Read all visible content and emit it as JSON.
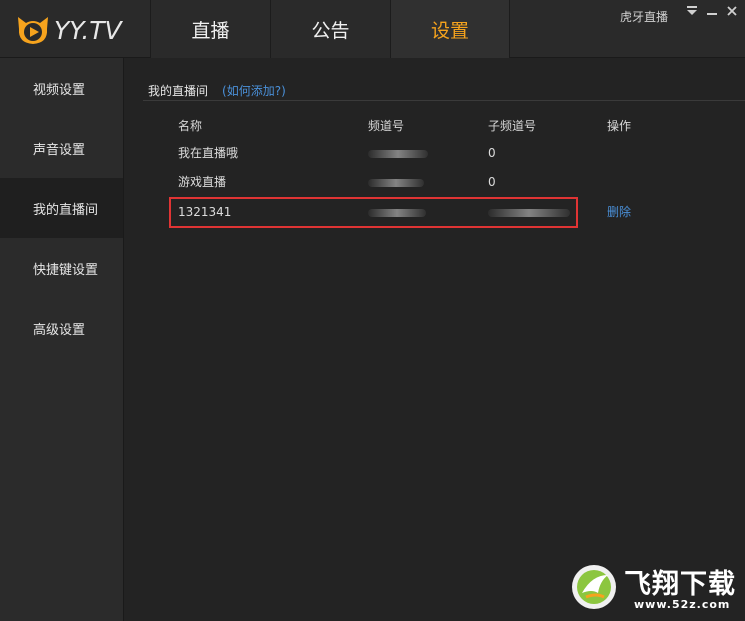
{
  "app": {
    "logo_text": "YY.TV",
    "brand_color": "#f6a31d",
    "user_name": "虎牙直播"
  },
  "nav": {
    "tabs": [
      {
        "label": "直播",
        "active": false
      },
      {
        "label": "公告",
        "active": false
      },
      {
        "label": "设置",
        "active": true
      }
    ]
  },
  "window_controls": {
    "menu_icon": "menu-down-icon",
    "minimize_icon": "minimize-icon",
    "close_icon": "close-icon"
  },
  "sidebar": {
    "items": [
      {
        "label": "视频设置",
        "active": false
      },
      {
        "label": "声音设置",
        "active": false
      },
      {
        "label": "我的直播间",
        "active": true
      },
      {
        "label": "快捷键设置",
        "active": false
      },
      {
        "label": "高级设置",
        "active": false
      }
    ]
  },
  "main": {
    "section_title": "我的直播间",
    "section_link": "(如何添加?)",
    "columns": [
      "名称",
      "频道号",
      "子频道号",
      "操作"
    ],
    "rows": [
      {
        "name": "我在直播哦",
        "channel": "",
        "sub_channel": "0",
        "action": ""
      },
      {
        "name": "游戏直播",
        "channel": "",
        "sub_channel": "0",
        "action": ""
      },
      {
        "name": "1321341",
        "channel": "",
        "sub_channel": "",
        "action": "删除"
      }
    ],
    "highlight_color": "#e03434",
    "link_color": "#4a90d9"
  },
  "watermark": {
    "text": "飞翔下载",
    "url": "www.52z.com"
  }
}
